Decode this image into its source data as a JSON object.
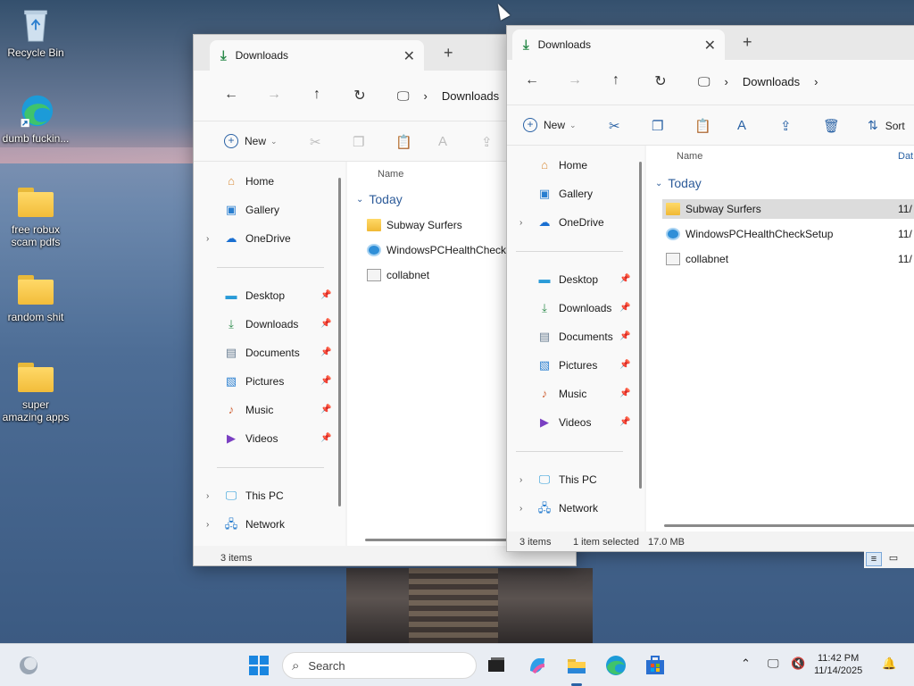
{
  "desktop": {
    "icons": [
      {
        "label": "Recycle Bin"
      },
      {
        "label": "dumb fuckin..."
      },
      {
        "label": "free robux scam pdfs"
      },
      {
        "label": "random shit"
      },
      {
        "label": "super amazing apps"
      }
    ]
  },
  "back_window": {
    "tab_title": "Downloads",
    "address": [
      "Downloads"
    ],
    "toolbar": {
      "new_label": "New"
    },
    "nav": {
      "home": "Home",
      "gallery": "Gallery",
      "onedrive": "OneDrive",
      "desktop": "Desktop",
      "downloads": "Downloads",
      "documents": "Documents",
      "pictures": "Pictures",
      "music": "Music",
      "videos": "Videos",
      "thispc": "This PC",
      "network": "Network"
    },
    "columns": {
      "name": "Name"
    },
    "group": "Today",
    "files": [
      "Subway Surfers",
      "WindowsPCHealthCheckS",
      "collabnet"
    ],
    "status": {
      "count": "3 items"
    }
  },
  "front_window": {
    "tab_title": "Downloads",
    "address": [
      "Downloads"
    ],
    "toolbar": {
      "new_label": "New",
      "sort_label": "Sort"
    },
    "nav": {
      "home": "Home",
      "gallery": "Gallery",
      "onedrive": "OneDrive",
      "desktop": "Desktop",
      "downloads": "Downloads",
      "documents": "Documents",
      "pictures": "Pictures",
      "music": "Music",
      "videos": "Videos",
      "thispc": "This PC",
      "network": "Network"
    },
    "columns": {
      "name": "Name",
      "date": "Dat"
    },
    "group": "Today",
    "files": [
      {
        "name": "Subway Surfers",
        "date": "11/",
        "selected": true
      },
      {
        "name": "WindowsPCHealthCheckSetup",
        "date": "11/"
      },
      {
        "name": "collabnet",
        "date": "11/"
      }
    ],
    "status": {
      "count": "3 items",
      "selection": "1 item selected",
      "size": "17.0 MB"
    }
  },
  "taskbar": {
    "search_placeholder": "Search",
    "time": "11:42 PM",
    "date": "11/14/2025"
  }
}
